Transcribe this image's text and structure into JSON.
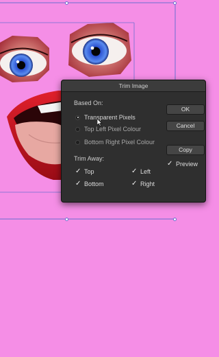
{
  "dialog": {
    "title": "Trim Image",
    "based_on_label": "Based On:",
    "based_on_options": [
      {
        "label": "Transparent Pixels",
        "selected": true
      },
      {
        "label": "Top Left Pixel Colour",
        "selected": false
      },
      {
        "label": "Bottom Right Pixel Colour",
        "selected": false
      }
    ],
    "trim_away_label": "Trim Away:",
    "trim_away": {
      "top": {
        "label": "Top",
        "checked": true
      },
      "left": {
        "label": "Left",
        "checked": true
      },
      "bottom": {
        "label": "Bottom",
        "checked": true
      },
      "right": {
        "label": "Right",
        "checked": true
      }
    },
    "buttons": {
      "ok": "OK",
      "cancel": "Cancel",
      "copy": "Copy"
    },
    "preview": {
      "label": "Preview",
      "checked": true
    }
  },
  "colors": {
    "canvas_background": "#f58ee6",
    "dialog_background": "#2f2f2f",
    "selection_outline": "#6b6fd0"
  }
}
